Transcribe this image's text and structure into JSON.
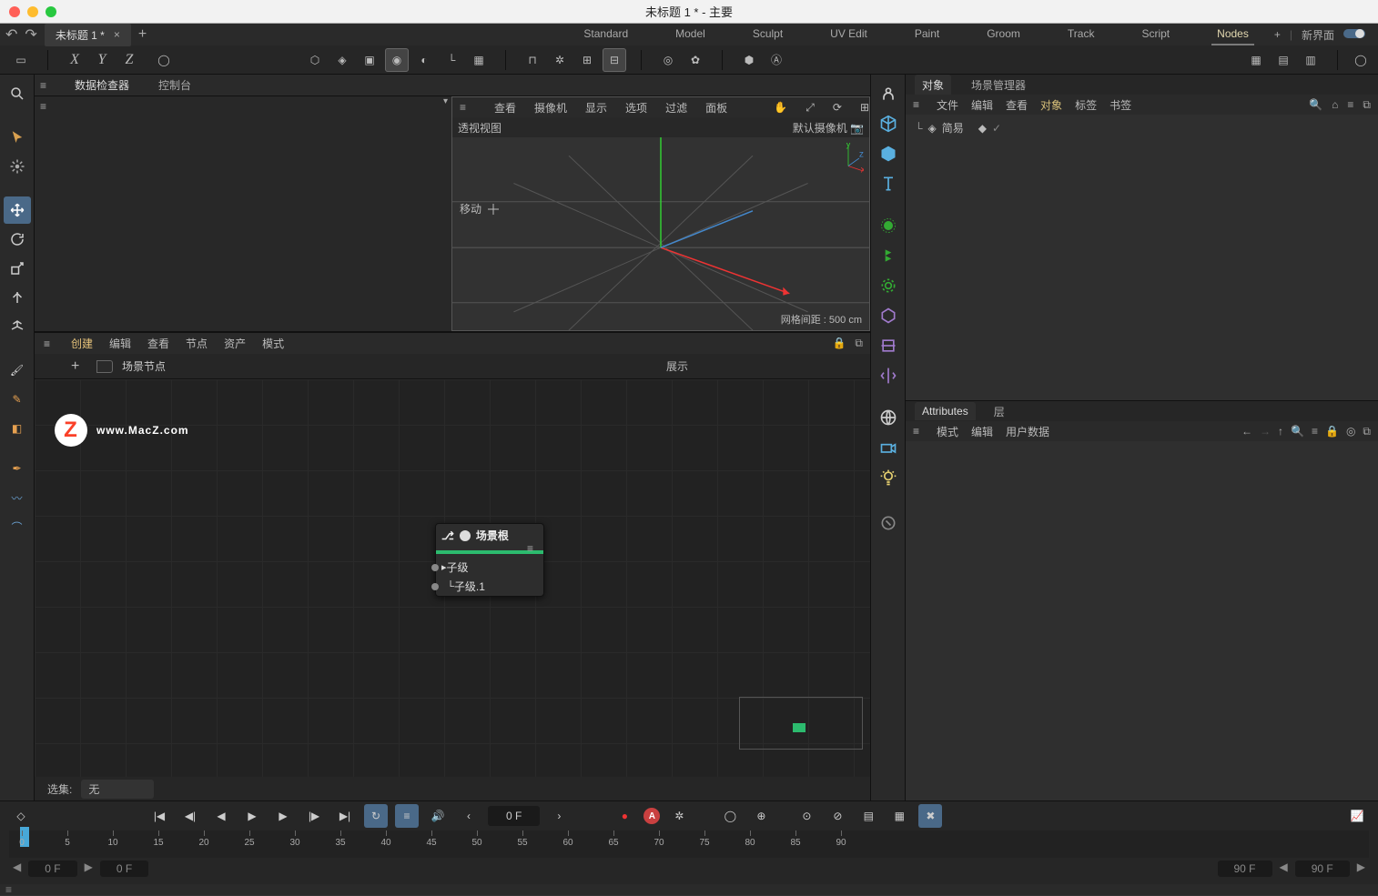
{
  "window": {
    "title": "未标题 1 * - 主要"
  },
  "doc_tab": "未标题 1 *",
  "layout_modes": [
    "Standard",
    "Model",
    "Sculpt",
    "UV Edit",
    "Paint",
    "Groom",
    "Track",
    "Script",
    "Nodes"
  ],
  "layout_active": "Nodes",
  "new_layout": "新界面",
  "history": {
    "undo": "↶",
    "redo": "↷"
  },
  "axes": [
    "X",
    "Y",
    "Z"
  ],
  "inspector": {
    "tabs": [
      "数据检查器",
      "控制台"
    ],
    "active": "数据检查器"
  },
  "viewport": {
    "menus": [
      "查看",
      "摄像机",
      "显示",
      "选项",
      "过滤",
      "面板"
    ],
    "title": "透视视图",
    "camera": "默认摄像机",
    "tool_hint": "移动",
    "grid_info": "网格间距 : 500 cm",
    "mini_axes": {
      "x": "x",
      "y": "y",
      "z": "z"
    }
  },
  "node_editor": {
    "menus": [
      "创建",
      "编辑",
      "查看",
      "节点",
      "资产",
      "模式"
    ],
    "active_menu": "创建",
    "breadcrumb": "场景节点",
    "display_label": "展示",
    "selection_label": "选集:",
    "selection_value": "无"
  },
  "node": {
    "title": "场景根",
    "ports": [
      "子级",
      "子级.1"
    ]
  },
  "object_mgr": {
    "tabs": [
      "对象",
      "场景管理器"
    ],
    "active_tab": "对象",
    "menus": [
      "文件",
      "编辑",
      "查看",
      "对象",
      "标签",
      "书签"
    ],
    "active_menu": "对象",
    "items": [
      "简易"
    ]
  },
  "attributes": {
    "tabs": [
      "Attributes",
      "层"
    ],
    "active_tab": "Attributes",
    "menus": [
      "模式",
      "编辑",
      "用户数据"
    ]
  },
  "timeline": {
    "frame": "0 F",
    "ticks": [
      0,
      5,
      10,
      15,
      20,
      25,
      30,
      35,
      40,
      45,
      50,
      55,
      60,
      65,
      70,
      75,
      80,
      85,
      90
    ],
    "range_start": "0 F",
    "range_start2": "0 F",
    "range_end": "90 F",
    "range_end2": "90 F"
  },
  "watermark": "www.MacZ.com"
}
